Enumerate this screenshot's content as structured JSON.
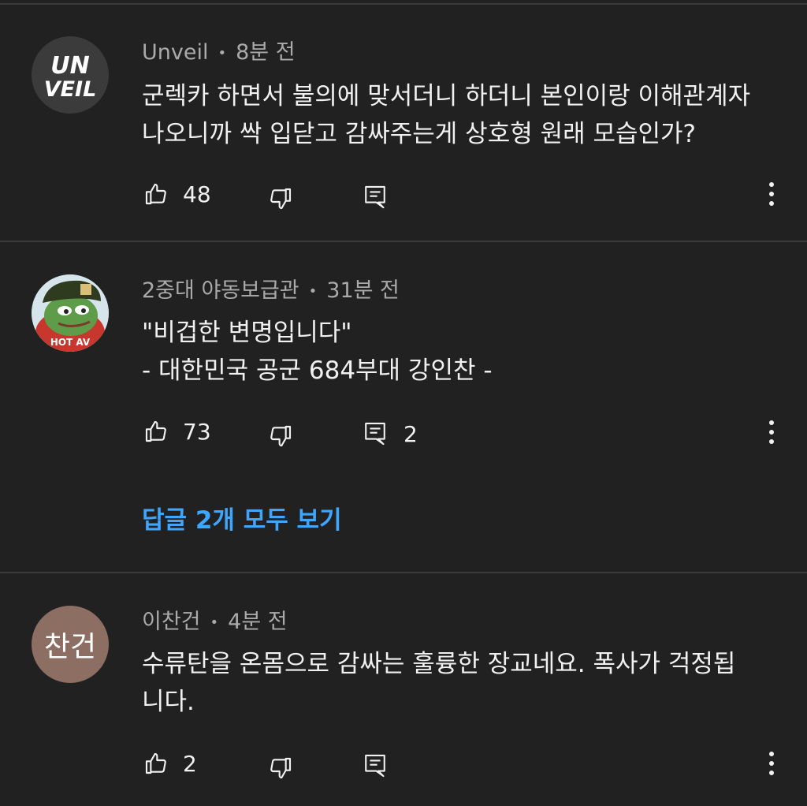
{
  "comments": [
    {
      "author": "Unveil",
      "time": "8분 전",
      "avatar_text_line1": "UN",
      "avatar_text_line2": "VEIL",
      "lines": [
        "군렉카 하면서 불의에 맞서더니 하더니 본인이랑 이해관계자",
        "나오니까 싹 입닫고 감싸주는게 상호형 원래 모습인가?"
      ],
      "likes": "48",
      "replies_count": ""
    },
    {
      "author": "2중대 야동보급관",
      "time": "31분 전",
      "avatar_badge_text": "HOT AV",
      "lines": [
        "\"비겁한 변명입니다\"",
        "- 대한민국 공군 684부대 강인찬 -"
      ],
      "likes": "73",
      "replies_count": "2",
      "view_replies": "답글 2개 모두 보기"
    },
    {
      "author": "이찬건",
      "time": "4분 전",
      "avatar_text": "찬건",
      "lines": [
        "수류탄을 온몸으로 감싸는 훌륭한 장교네요. 폭사가 걱정됩",
        "니다."
      ],
      "likes": "2",
      "replies_count": ""
    }
  ],
  "meta_separator": "•",
  "colors": {
    "background": "#212121",
    "text_primary": "#f1f1f1",
    "text_secondary": "#aaaaaa",
    "link": "#3ea6ff",
    "divider": "#3a3a3a",
    "avatar3_bg": "#8d6e63"
  },
  "icons": [
    "thumbs-up-icon",
    "thumbs-down-icon",
    "reply-icon",
    "more-vert-icon"
  ]
}
